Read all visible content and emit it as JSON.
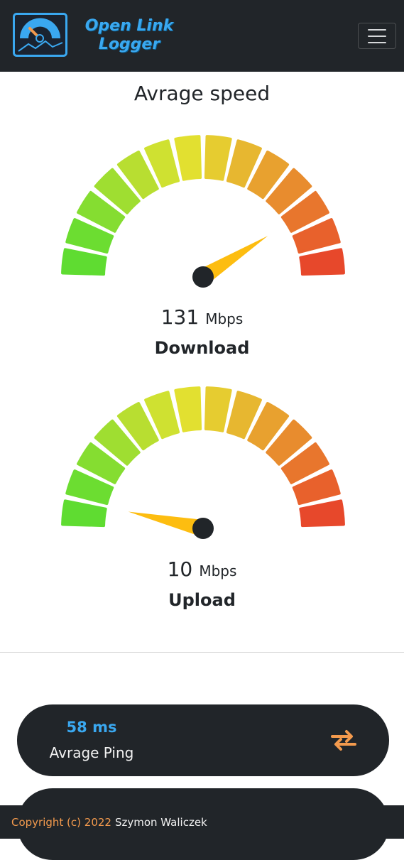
{
  "navbar": {
    "logo_line1": "Open Link",
    "logo_line2": "Logger",
    "menu_icon": "hamburger-icon"
  },
  "title": "Avrage speed",
  "gauges": {
    "download": {
      "value": "131",
      "unit": "Mbps",
      "label": "Download",
      "level": 0.82
    },
    "upload": {
      "value": "10",
      "unit": "Mbps",
      "label": "Upload",
      "level": 0.07
    }
  },
  "stats": {
    "ping": {
      "value": "58 ms",
      "label": "Avrage Ping",
      "icon": "swap-arrows-icon"
    }
  },
  "footer": {
    "copyright": "Copyright (c) 2022",
    "author": "Szymon Waliczek"
  },
  "colors": {
    "dark": "#212529",
    "accent_blue": "#3aa8f0",
    "accent_orange": "#f39a4d",
    "needle": "#fdbd10"
  }
}
